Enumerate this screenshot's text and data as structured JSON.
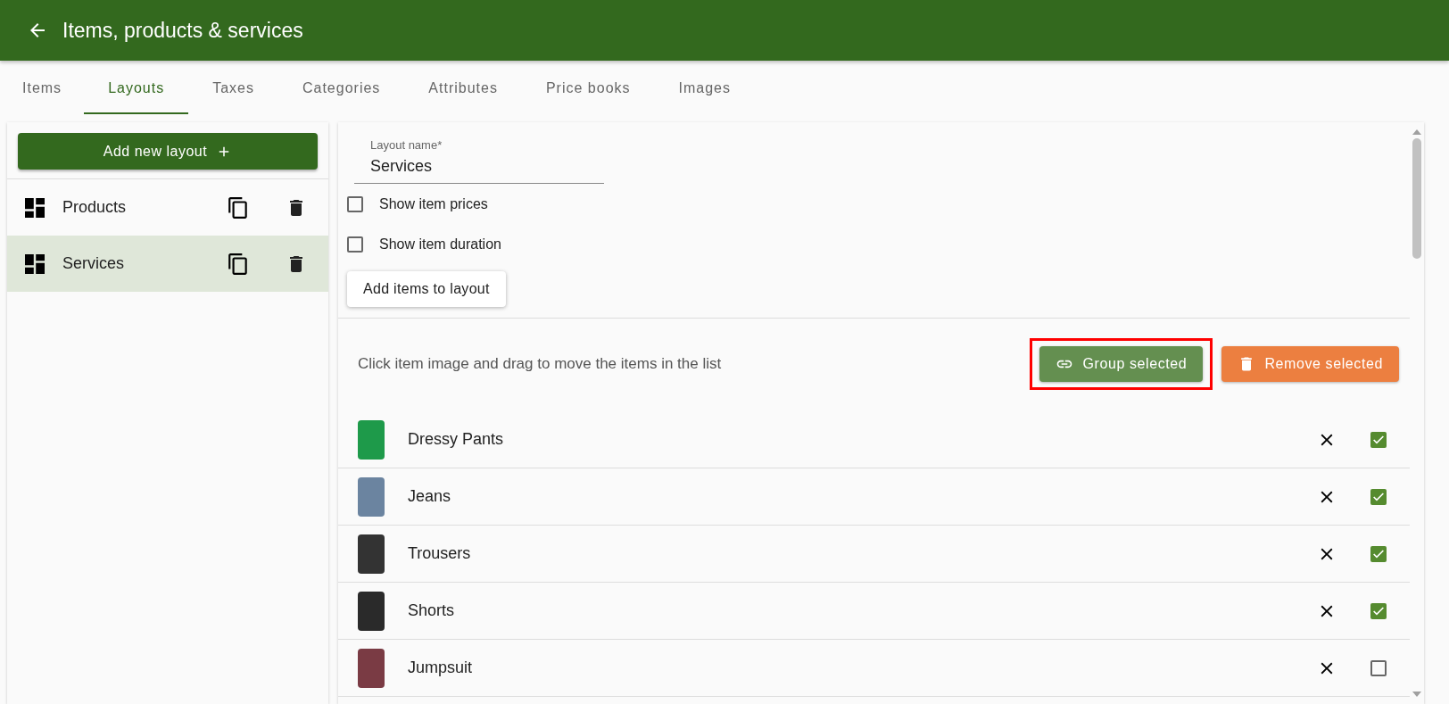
{
  "header": {
    "title": "Items, products & services"
  },
  "tabs": [
    {
      "label": "Items",
      "selected": false
    },
    {
      "label": "Layouts",
      "selected": true
    },
    {
      "label": "Taxes",
      "selected": false
    },
    {
      "label": "Categories",
      "selected": false
    },
    {
      "label": "Attributes",
      "selected": false
    },
    {
      "label": "Price books",
      "selected": false
    },
    {
      "label": "Images",
      "selected": false
    }
  ],
  "sidebar": {
    "add_button": "Add new layout",
    "items": [
      {
        "label": "Products",
        "selected": false
      },
      {
        "label": "Services",
        "selected": true
      }
    ]
  },
  "editor": {
    "field": {
      "label": "Layout name*",
      "value": "Services"
    },
    "options": [
      {
        "label": "Show item prices",
        "checked": false
      },
      {
        "label": "Show item duration",
        "checked": false
      }
    ],
    "add_items_button": "Add items to layout",
    "hint": "Click item image and drag to move the items in the list",
    "group_button": {
      "label": "Group selected",
      "highlighted": true
    },
    "remove_button": "Remove selected",
    "items": [
      {
        "name": "Dressy Pants",
        "color": "#1e9a4a",
        "checked": true
      },
      {
        "name": "Jeans",
        "color": "#6b84a0",
        "checked": true
      },
      {
        "name": "Trousers",
        "color": "#333333",
        "checked": true
      },
      {
        "name": "Shorts",
        "color": "#2a2a2a",
        "checked": true
      },
      {
        "name": "Jumpsuit",
        "color": "#7a3b44",
        "checked": false
      }
    ]
  }
}
